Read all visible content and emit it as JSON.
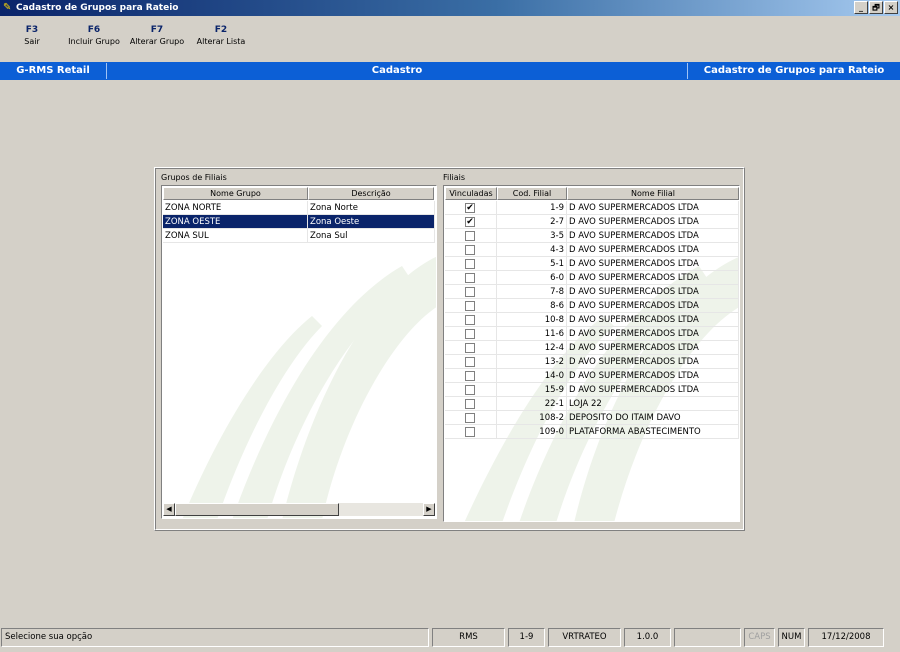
{
  "window": {
    "title": "Cadastro de Grupos para Rateio",
    "controls": [
      "_",
      "🗗",
      "×"
    ]
  },
  "toolbar": {
    "items": [
      {
        "key": "F3",
        "label": "Sair"
      },
      {
        "key": "F6",
        "label": "Incluir Grupo"
      },
      {
        "key": "F7",
        "label": "Alterar Grupo"
      },
      {
        "key": "F2",
        "label": "Alterar Lista"
      }
    ]
  },
  "header": {
    "app": "G-RMS Retail",
    "section": "Cadastro",
    "screen": "Cadastro de Grupos para Rateio",
    "color": "#0c5fd6"
  },
  "groups": {
    "title": "Grupos de Filiais",
    "columns": [
      "Nome Grupo",
      "Descrição"
    ],
    "rows": [
      {
        "name": "ZONA NORTE",
        "desc": "Zona Norte"
      },
      {
        "name": "ZONA OESTE",
        "desc": "Zona Oeste"
      },
      {
        "name": "ZONA SUL",
        "desc": "Zona Sul"
      }
    ],
    "selected_index": 1
  },
  "branches": {
    "title": "Filiais",
    "columns": [
      "Vinculadas",
      "Cod. Filial",
      "Nome Filial"
    ],
    "rows": [
      {
        "linked": true,
        "code": "1-9",
        "name": "D AVO SUPERMERCADOS LTDA"
      },
      {
        "linked": true,
        "code": "2-7",
        "name": "D AVO SUPERMERCADOS LTDA"
      },
      {
        "linked": false,
        "code": "3-5",
        "name": "D AVO SUPERMERCADOS LTDA"
      },
      {
        "linked": false,
        "code": "4-3",
        "name": "D AVO SUPERMERCADOS LTDA"
      },
      {
        "linked": false,
        "code": "5-1",
        "name": "D AVO SUPERMERCADOS LTDA"
      },
      {
        "linked": false,
        "code": "6-0",
        "name": "D AVO SUPERMERCADOS LTDA"
      },
      {
        "linked": false,
        "code": "7-8",
        "name": "D AVO SUPERMERCADOS LTDA"
      },
      {
        "linked": false,
        "code": "8-6",
        "name": "D AVO SUPERMERCADOS LTDA"
      },
      {
        "linked": false,
        "code": "10-8",
        "name": "D AVO SUPERMERCADOS LTDA"
      },
      {
        "linked": false,
        "code": "11-6",
        "name": "D AVO SUPERMERCADOS LTDA"
      },
      {
        "linked": false,
        "code": "12-4",
        "name": "D AVO SUPERMERCADOS LTDA"
      },
      {
        "linked": false,
        "code": "13-2",
        "name": "D AVO SUPERMERCADOS LTDA"
      },
      {
        "linked": false,
        "code": "14-0",
        "name": "D AVO SUPERMERCADOS LTDA"
      },
      {
        "linked": false,
        "code": "15-9",
        "name": "D AVO SUPERMERCADOS LTDA"
      },
      {
        "linked": false,
        "code": "22-1",
        "name": "LOJA 22"
      },
      {
        "linked": false,
        "code": "108-2",
        "name": "DEPOSITO DO ITAIM DAVO"
      },
      {
        "linked": false,
        "code": "109-0",
        "name": "PLATAFORMA ABASTECIMENTO"
      }
    ]
  },
  "status": {
    "message": "Selecione sua opção",
    "system": "RMS",
    "branch": "1-9",
    "program": "VRTRATEO",
    "version": "1.0.0",
    "blank": "",
    "caps": "CAPS",
    "num": "NUM",
    "date": "17/12/2008"
  }
}
